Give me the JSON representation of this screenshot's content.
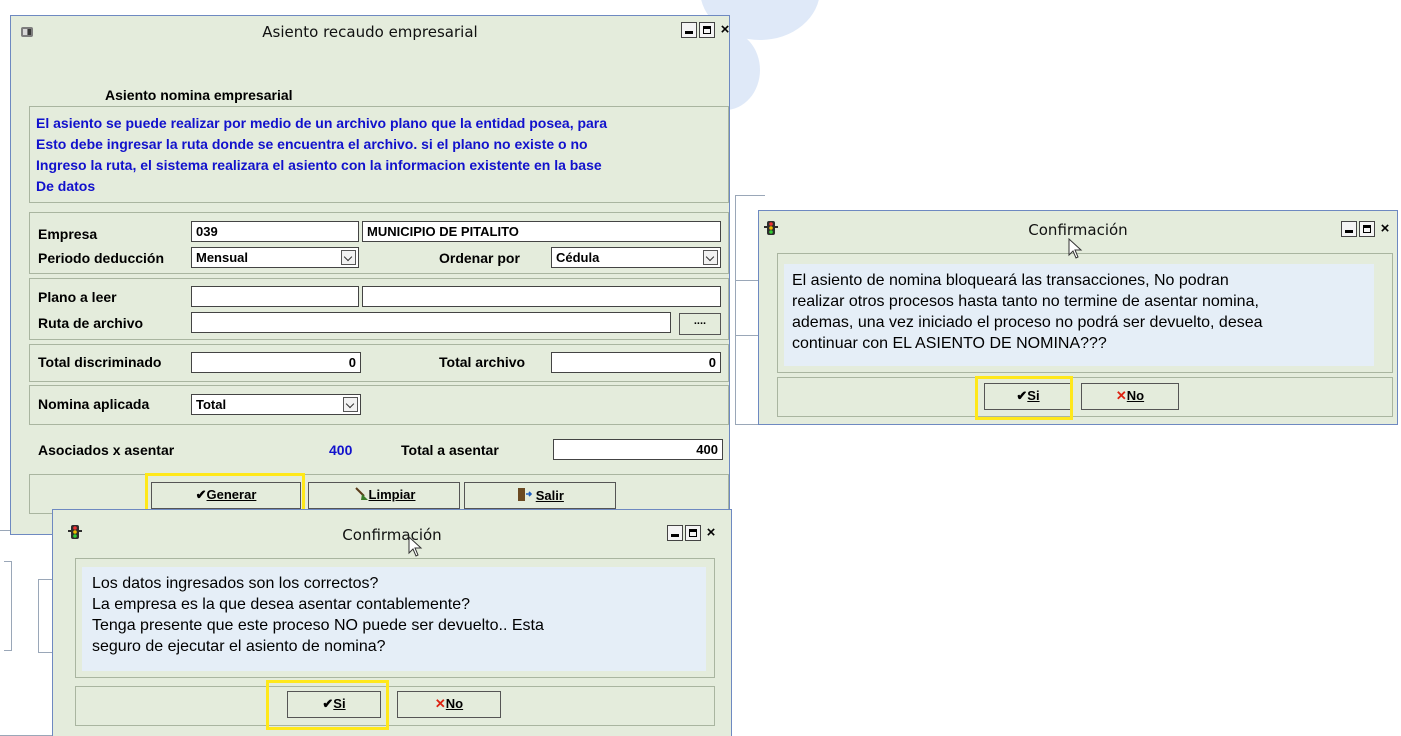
{
  "main_window": {
    "title": "Asiento recaudo empresarial",
    "section_title": "Asiento nomina empresarial",
    "info_lines": [
      "El asiento se puede realizar por medio de un archivo plano que la entidad posea, para",
      "Esto debe ingresar la ruta donde se encuentra el archivo. si el plano no existe o no",
      "Ingreso la ruta, el sistema realizara el asiento con la informacion existente en la base",
      "De datos"
    ],
    "empresa": {
      "label": "Empresa",
      "code": "039",
      "name": "MUNICIPIO DE PITALITO"
    },
    "periodo": {
      "label": "Periodo deducción",
      "value": "Mensual"
    },
    "ordenar": {
      "label": "Ordenar por",
      "value": "Cédula"
    },
    "plano": {
      "label": "Plano a leer",
      "value1": "",
      "value2": ""
    },
    "ruta": {
      "label": "Ruta de archivo",
      "value": "",
      "browse_label": "...."
    },
    "total_discriminado": {
      "label": "Total discriminado",
      "value": "0"
    },
    "total_archivo": {
      "label": "Total archivo",
      "value": "0"
    },
    "nomina_aplicada": {
      "label": "Nomina aplicada",
      "value": "Total"
    },
    "asociados": {
      "label": "Asociados x asentar",
      "value": "400"
    },
    "total_asentar": {
      "label": "Total a asentar",
      "value": "400"
    },
    "buttons": {
      "generar": "Generar",
      "limpiar": "Limpiar",
      "salir": "Salir"
    }
  },
  "confirm_bottom": {
    "title": "Confirmación",
    "lines": [
      "Los datos ingresados son los correctos?",
      "La empresa es la que desea asentar contablemente?",
      "Tenga presente que este proceso NO puede ser devuelto.. Esta",
      "seguro de ejecutar el asiento de nomina?"
    ],
    "yes": "Si",
    "no": "No"
  },
  "confirm_right": {
    "title": "Confirmación",
    "lines": [
      "El asiento de nomina bloqueará las transacciones, No podran",
      "realizar otros procesos hasta tanto no termine de asentar nomina,",
      "ademas, una vez iniciado el proceso no podrá ser devuelto, desea",
      "continuar con EL ASIENTO DE NOMINA???"
    ],
    "yes": "Si",
    "no": "No"
  },
  "colors": {
    "window_bg": "#e4ecdc",
    "border_blue": "#6e89c1",
    "info_text": "#1111cc",
    "highlight": "#ffe81a",
    "message_bg": "#e5eef7"
  },
  "icons": [
    "app-icon",
    "traffic-light-icon",
    "checkmark-icon",
    "broom-icon",
    "exit-door-icon",
    "x-icon",
    "mouse-cursor-icon"
  ]
}
